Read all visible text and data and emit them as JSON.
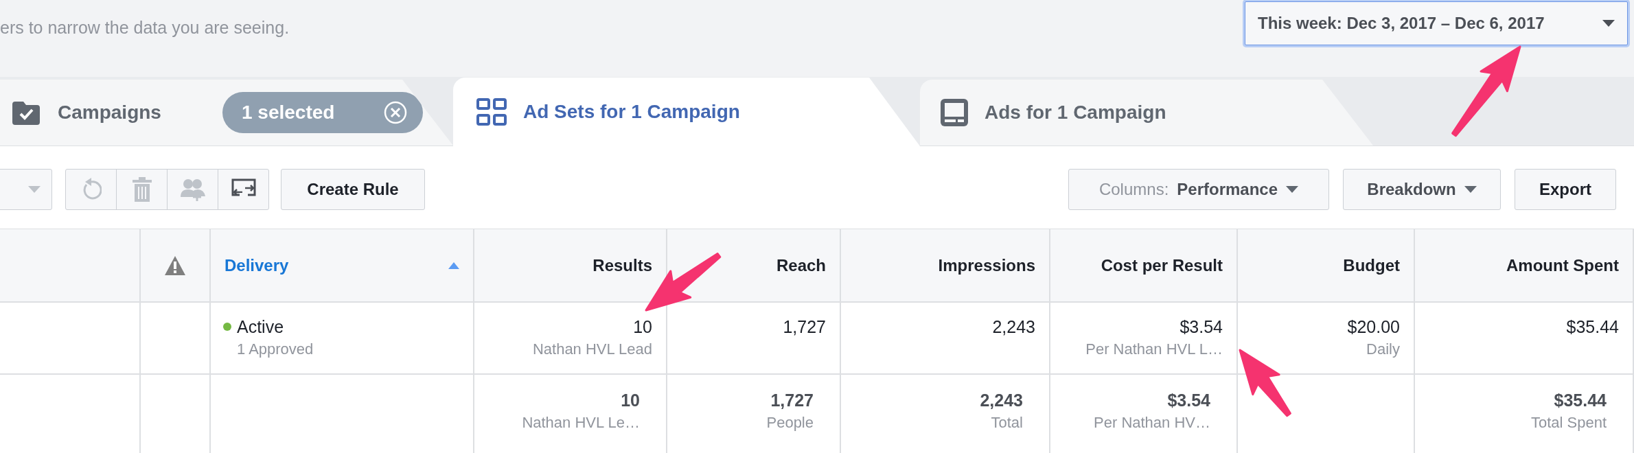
{
  "filter_hint": "ers to narrow the data you are seeing.",
  "date_range": {
    "label": "This week: Dec 3, 2017 – Dec 6, 2017",
    "focused": true
  },
  "tabs": [
    {
      "kind": "campaigns",
      "label": "Campaigns",
      "selected": false,
      "badge": "1 selected"
    },
    {
      "kind": "adsets",
      "label": "Ad Sets for 1 Campaign",
      "selected": true
    },
    {
      "kind": "ads",
      "label": "Ads for 1 Campaign",
      "selected": false
    }
  ],
  "toolbar": {
    "icon_buttons": [
      {
        "kind": "dropdown",
        "disabled": true
      },
      {
        "kind": "undo",
        "disabled": true
      },
      {
        "kind": "delete",
        "disabled": true
      },
      {
        "kind": "audience",
        "disabled": true
      },
      {
        "kind": "swap",
        "disabled": false
      }
    ],
    "create_rule": "Create Rule",
    "columns": {
      "label": "Columns:",
      "value": "Performance"
    },
    "breakdown": "Breakdown",
    "export": "Export"
  },
  "table": {
    "columns": [
      {
        "kind": "blank"
      },
      {
        "kind": "warning"
      },
      {
        "kind": "status",
        "label": "Delivery",
        "sorted": true
      },
      {
        "kind": "number",
        "label": "Results",
        "sorted": false
      },
      {
        "kind": "number",
        "label": "Reach",
        "sorted": false
      },
      {
        "kind": "number",
        "label": "Impressions",
        "sorted": false
      },
      {
        "kind": "number",
        "label": "Cost per Result",
        "sorted": false
      },
      {
        "kind": "number",
        "label": "Budget",
        "sorted": false
      },
      {
        "kind": "number",
        "label": "Amount Spent",
        "sorted": false
      }
    ],
    "rows": [
      {
        "kind": "item",
        "cells": [
          null,
          null,
          {
            "status": "Active",
            "detail": "1 Approved",
            "color": "#75b943"
          },
          {
            "value": "10",
            "sub": "Nathan HVL Lead"
          },
          {
            "value": "1,727"
          },
          {
            "value": "2,243"
          },
          {
            "value": "$3.54",
            "sub": "Per Nathan HVL L…"
          },
          {
            "value": "$20.00",
            "sub": "Daily"
          },
          {
            "value": "$35.44"
          }
        ]
      },
      {
        "kind": "total",
        "cells": [
          null,
          null,
          null,
          {
            "value": "10",
            "sub": "Nathan HVL Le…"
          },
          {
            "value": "1,727",
            "sub": "People"
          },
          {
            "value": "2,243",
            "sub": "Total"
          },
          {
            "value": "$3.54",
            "sub": "Per Nathan HV…"
          },
          null,
          {
            "value": "$35.44",
            "sub": "Total Spent"
          }
        ]
      }
    ]
  }
}
